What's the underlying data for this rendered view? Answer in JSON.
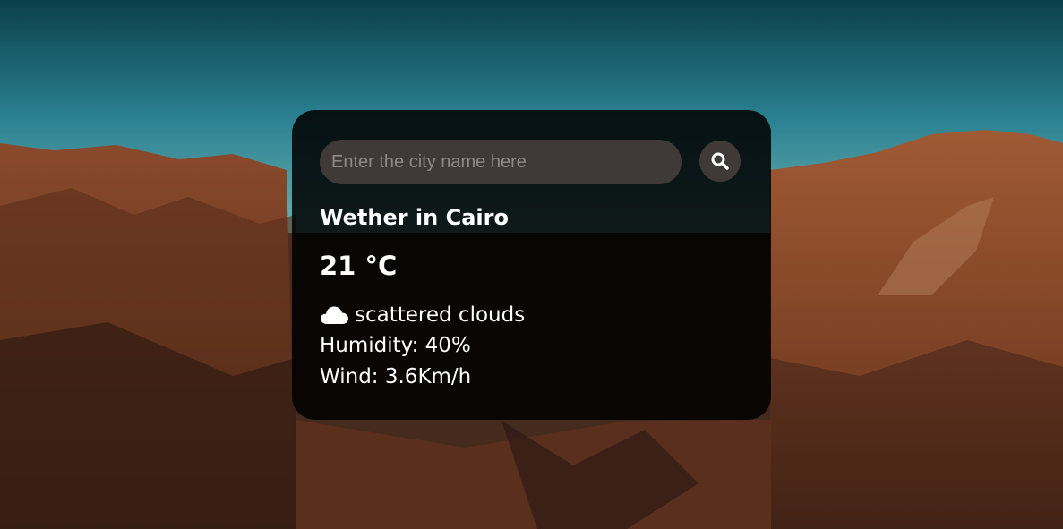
{
  "search": {
    "placeholder": "Enter the city name here",
    "value": "",
    "button_icon": "search-icon"
  },
  "weather": {
    "title": "Wether in Cairo",
    "temperature": "21 °C",
    "condition_icon": "cloud-icon",
    "description": "scattered clouds",
    "humidity": "Humidity: 40%",
    "wind": "Wind: 3.6Km/h"
  },
  "colors": {
    "card_background": "#000000",
    "input_background": "#3f3a38",
    "text": "#ffffff",
    "placeholder": "#8f8a88"
  }
}
